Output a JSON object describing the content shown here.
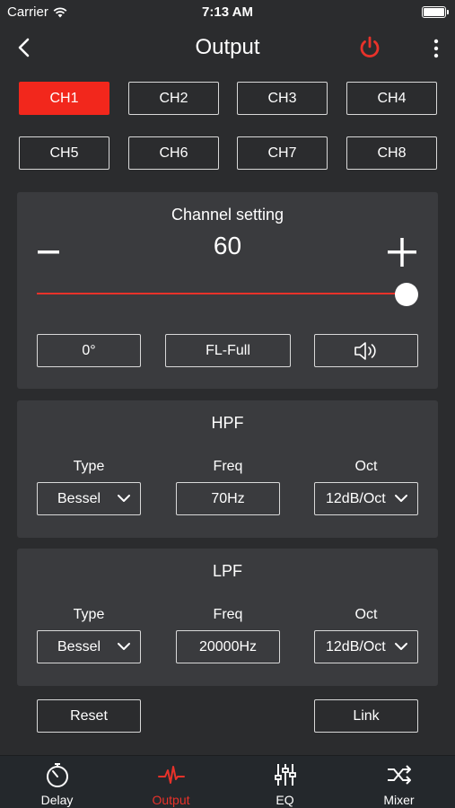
{
  "status": {
    "carrier": "Carrier",
    "time": "7:13 AM"
  },
  "nav": {
    "title": "Output",
    "power_color": "#e8322a"
  },
  "channels": {
    "active_color": "#f2271c",
    "items": [
      "CH1",
      "CH2",
      "CH3",
      "CH4",
      "CH5",
      "CH6",
      "CH7",
      "CH8"
    ],
    "selected": "CH1"
  },
  "channel_setting": {
    "title": "Channel setting",
    "minus": "−",
    "value": "60",
    "plus": "+",
    "slider_fraction": 1.0,
    "phase": "0°",
    "speaker": "FL-Full",
    "audio_icon": "speaker-icon"
  },
  "hpf": {
    "title": "HPF",
    "type_label": "Type",
    "freq_label": "Freq",
    "oct_label": "Oct",
    "type_value": "Bessel",
    "freq_value": "70Hz",
    "oct_value": "12dB/Oct"
  },
  "lpf": {
    "title": "LPF",
    "type_label": "Type",
    "freq_label": "Freq",
    "oct_label": "Oct",
    "type_value": "Bessel",
    "freq_value": "20000Hz",
    "oct_value": "12dB/Oct"
  },
  "actions": {
    "reset": "Reset",
    "link": "Link"
  },
  "tabs": [
    {
      "label": "Delay",
      "icon": "stopwatch-icon"
    },
    {
      "label": "Output",
      "icon": "waveform-icon"
    },
    {
      "label": "EQ",
      "icon": "sliders-icon"
    },
    {
      "label": "Mixer",
      "icon": "crossover-arrows-icon"
    }
  ],
  "active_tab": "Output"
}
